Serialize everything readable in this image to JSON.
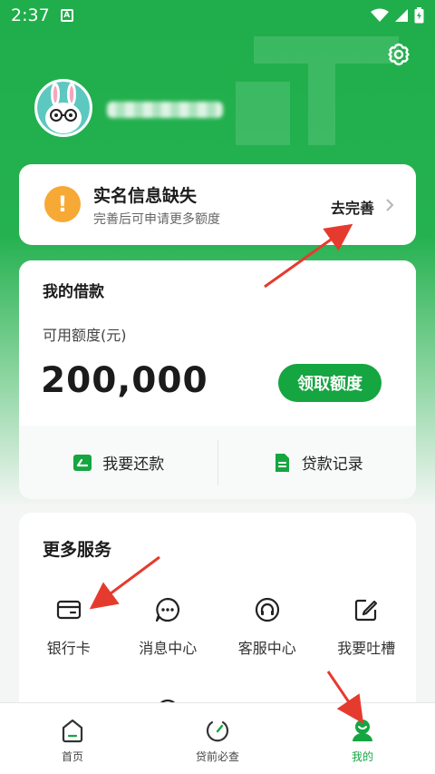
{
  "status_bar": {
    "time": "2:37",
    "notif_glyph": "A"
  },
  "profile": {
    "username": ""
  },
  "realname_card": {
    "title": "实名信息缺失",
    "subtitle": "完善后可申请更多额度",
    "action": "去完善"
  },
  "loan_card": {
    "title": "我的借款",
    "label": "可用额度(元)",
    "amount": "200,000",
    "button": "领取额度",
    "repay": "我要还款",
    "records": "贷款记录"
  },
  "services": {
    "title": "更多服务",
    "items": [
      {
        "label": "银行卡",
        "icon": "bank-card-icon"
      },
      {
        "label": "消息中心",
        "icon": "message-icon"
      },
      {
        "label": "客服中心",
        "icon": "headset-icon"
      },
      {
        "label": "我要吐槽",
        "icon": "feedback-edit-icon"
      }
    ]
  },
  "bottom_nav": {
    "items": [
      {
        "label": "首页",
        "icon": "home-icon"
      },
      {
        "label": "贷前必查",
        "icon": "gauge-icon"
      },
      {
        "label": "我的",
        "icon": "user-icon",
        "active": true
      }
    ]
  },
  "colors": {
    "brand_green": "#15a541",
    "warning_orange": "#f7a935",
    "annotation_red": "#e53b2e"
  }
}
